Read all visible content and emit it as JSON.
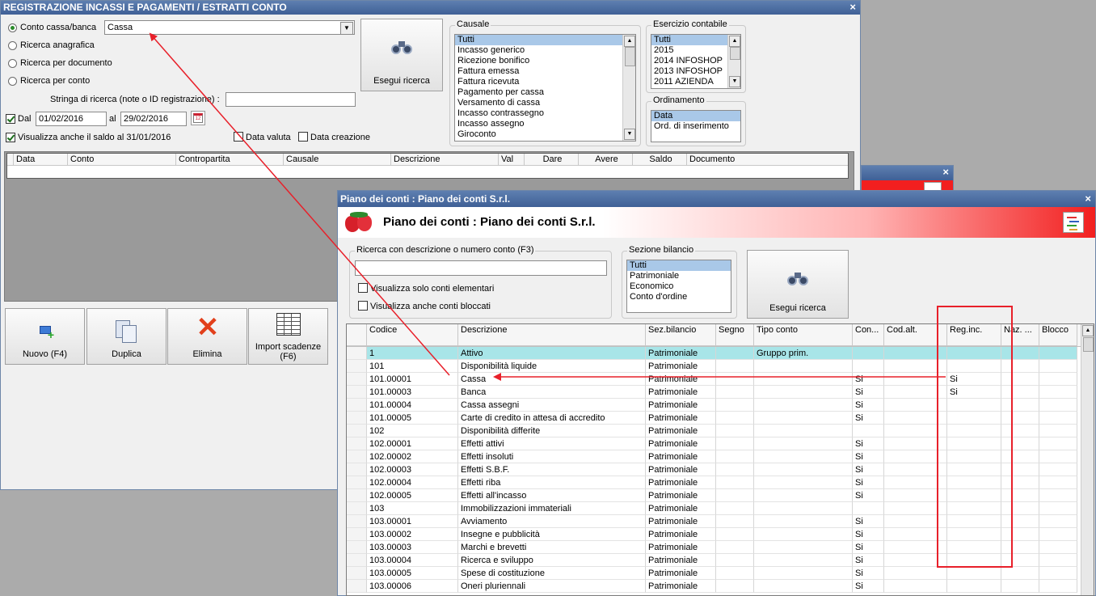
{
  "main": {
    "title": "REGISTRAZIONE INCASSI E PAGAMENTI / ESTRATTI CONTO",
    "close": "×",
    "radios": [
      {
        "label": "Conto cassa/banca",
        "checked": true
      },
      {
        "label": "Ricerca anagrafica",
        "checked": false
      },
      {
        "label": "Ricerca per documento",
        "checked": false
      },
      {
        "label": "Ricerca per conto",
        "checked": false
      }
    ],
    "account_value": "Cassa",
    "search_string_label": "Stringa di ricerca (note o ID registrazione) :",
    "search_string_value": "",
    "dal_label": "Dal",
    "date_from": "01/02/2016",
    "al_label": "al",
    "date_to": "29/02/2016",
    "saldo_label": "Visualizza anche il saldo al 31/01/2016",
    "data_valuta_label": "Data valuta",
    "data_creazione_label": "Data creazione",
    "search_button": "Esegui ricerca",
    "causale_title": "Causale",
    "causale_items": [
      "Tutti",
      "Incasso generico",
      "Ricezione bonifico",
      "Fattura emessa",
      "Fattura ricevuta",
      "Pagamento per cassa",
      "Versamento di cassa",
      "Incasso contrassegno",
      "Incasso assegno",
      "Giroconto"
    ],
    "esercizio_title": "Esercizio contabile",
    "esercizio_items": [
      "Tutti",
      "2015",
      "2014 INFOSHOP",
      "2013 INFOSHOP",
      "2011 AZIENDA"
    ],
    "ordinamento_title": "Ordinamento",
    "ordinamento_items": [
      "Data",
      "Ord. di inserimento"
    ],
    "grid_headers": [
      "Data",
      "Conto",
      "Contropartita",
      "Causale",
      "Descrizione",
      "Val",
      "Dare",
      "Avere",
      "Saldo",
      "Documento"
    ],
    "buttons": {
      "nuovo": "Nuovo (F4)",
      "duplica": "Duplica",
      "elimina": "Elimina",
      "import": "Import scadenze (F6)"
    }
  },
  "background_window": {
    "close": "×"
  },
  "piano": {
    "title": "Piano dei conti : Piano dei conti S.r.l.",
    "header_title": "Piano dei conti : Piano dei conti S.r.l.",
    "close": "×",
    "search_group_title": "Ricerca con descrizione o numero conto (F3)",
    "search_value": "",
    "chk_elementari": "Visualizza solo conti elementari",
    "chk_bloccati": "Visualizza anche conti bloccati",
    "sezione_title": "Sezione bilancio",
    "sezione_items": [
      "Tutti",
      "Patrimoniale",
      "Economico",
      "Conto d'ordine"
    ],
    "search_button": "Esegui ricerca",
    "columns": [
      "Codice",
      "Descrizione",
      "Sez.bilancio",
      "Segno",
      "Tipo conto",
      "Con...",
      "Cod.alt.",
      "Reg.inc.",
      "Naz. ...",
      "Blocco"
    ],
    "rows": [
      {
        "codice": "1",
        "descrizione": "Attivo",
        "sez": "Patrimoniale",
        "segno": "",
        "tipo": "Gruppo prim.",
        "con": "",
        "codalt": "",
        "reginc": "",
        "naz": "",
        "blocco": ""
      },
      {
        "codice": "101",
        "descrizione": "Disponibilità liquide",
        "sez": "Patrimoniale",
        "segno": "",
        "tipo": "",
        "con": "",
        "codalt": "",
        "reginc": "",
        "naz": "",
        "blocco": ""
      },
      {
        "codice": "101.00001",
        "descrizione": "Cassa",
        "sez": "Patrimoniale",
        "segno": "",
        "tipo": "",
        "con": "Si",
        "codalt": "",
        "reginc": "Si",
        "naz": "",
        "blocco": ""
      },
      {
        "codice": "101.00003",
        "descrizione": "Banca",
        "sez": "Patrimoniale",
        "segno": "",
        "tipo": "",
        "con": "Si",
        "codalt": "",
        "reginc": "Si",
        "naz": "",
        "blocco": ""
      },
      {
        "codice": "101.00004",
        "descrizione": "Cassa assegni",
        "sez": "Patrimoniale",
        "segno": "",
        "tipo": "",
        "con": "Si",
        "codalt": "",
        "reginc": "",
        "naz": "",
        "blocco": ""
      },
      {
        "codice": "101.00005",
        "descrizione": "Carte di credito in attesa di accredito",
        "sez": "Patrimoniale",
        "segno": "",
        "tipo": "",
        "con": "Si",
        "codalt": "",
        "reginc": "",
        "naz": "",
        "blocco": ""
      },
      {
        "codice": "102",
        "descrizione": "Disponibilità differite",
        "sez": "Patrimoniale",
        "segno": "",
        "tipo": "",
        "con": "",
        "codalt": "",
        "reginc": "",
        "naz": "",
        "blocco": ""
      },
      {
        "codice": "102.00001",
        "descrizione": "Effetti attivi",
        "sez": "Patrimoniale",
        "segno": "",
        "tipo": "",
        "con": "Si",
        "codalt": "",
        "reginc": "",
        "naz": "",
        "blocco": ""
      },
      {
        "codice": "102.00002",
        "descrizione": "Effetti insoluti",
        "sez": "Patrimoniale",
        "segno": "",
        "tipo": "",
        "con": "Si",
        "codalt": "",
        "reginc": "",
        "naz": "",
        "blocco": ""
      },
      {
        "codice": "102.00003",
        "descrizione": "Effetti S.B.F.",
        "sez": "Patrimoniale",
        "segno": "",
        "tipo": "",
        "con": "Si",
        "codalt": "",
        "reginc": "",
        "naz": "",
        "blocco": ""
      },
      {
        "codice": "102.00004",
        "descrizione": "Effetti riba",
        "sez": "Patrimoniale",
        "segno": "",
        "tipo": "",
        "con": "Si",
        "codalt": "",
        "reginc": "",
        "naz": "",
        "blocco": ""
      },
      {
        "codice": "102.00005",
        "descrizione": "Effetti all'incasso",
        "sez": "Patrimoniale",
        "segno": "",
        "tipo": "",
        "con": "Si",
        "codalt": "",
        "reginc": "",
        "naz": "",
        "blocco": ""
      },
      {
        "codice": "103",
        "descrizione": "Immobilizzazioni immateriali",
        "sez": "Patrimoniale",
        "segno": "",
        "tipo": "",
        "con": "",
        "codalt": "",
        "reginc": "",
        "naz": "",
        "blocco": ""
      },
      {
        "codice": "103.00001",
        "descrizione": "Avviamento",
        "sez": "Patrimoniale",
        "segno": "",
        "tipo": "",
        "con": "Si",
        "codalt": "",
        "reginc": "",
        "naz": "",
        "blocco": ""
      },
      {
        "codice": "103.00002",
        "descrizione": "Insegne e pubblicità",
        "sez": "Patrimoniale",
        "segno": "",
        "tipo": "",
        "con": "Si",
        "codalt": "",
        "reginc": "",
        "naz": "",
        "blocco": ""
      },
      {
        "codice": "103.00003",
        "descrizione": "Marchi e brevetti",
        "sez": "Patrimoniale",
        "segno": "",
        "tipo": "",
        "con": "Si",
        "codalt": "",
        "reginc": "",
        "naz": "",
        "blocco": ""
      },
      {
        "codice": "103.00004",
        "descrizione": "Ricerca e sviluppo",
        "sez": "Patrimoniale",
        "segno": "",
        "tipo": "",
        "con": "Si",
        "codalt": "",
        "reginc": "",
        "naz": "",
        "blocco": ""
      },
      {
        "codice": "103.00005",
        "descrizione": "Spese di costituzione",
        "sez": "Patrimoniale",
        "segno": "",
        "tipo": "",
        "con": "Si",
        "codalt": "",
        "reginc": "",
        "naz": "",
        "blocco": ""
      },
      {
        "codice": "103.00006",
        "descrizione": "Oneri pluriennali",
        "sez": "Patrimoniale",
        "segno": "",
        "tipo": "",
        "con": "Si",
        "codalt": "",
        "reginc": "",
        "naz": "",
        "blocco": ""
      }
    ]
  },
  "colors": {
    "annotation": "#e8202a",
    "row_highlight": "#a8e5e8",
    "title_bar": "#4a6ba0"
  }
}
